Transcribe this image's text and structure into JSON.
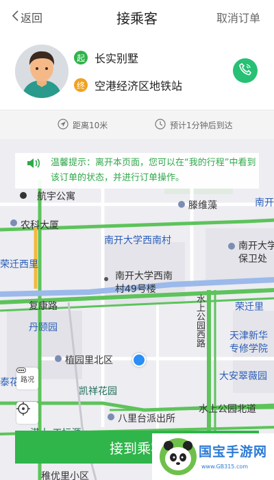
{
  "header": {
    "back_label": "返回",
    "title": "接乘客",
    "cancel_label": "取消订单"
  },
  "passenger": {
    "start_tag": "起",
    "start": "长实别墅",
    "end_tag": "终",
    "end": "空港经济区地铁站"
  },
  "trip_info": {
    "distance": "距离10米",
    "eta": "预计1分钟后到达"
  },
  "tip": {
    "text": "温馨提示：离开本页面，您可以在“我的行程”中看到该订单的状态，并进行订单操作。"
  },
  "map": {
    "labels": {
      "hangyu": "航宇公寓",
      "tengweizao": "滕维藻",
      "nankai_corner": "南开",
      "nongke": "农科大厦",
      "nankai_xinan": "南开大学西南村",
      "nankai_baowei": "南开大学",
      "baowei": "保卫处",
      "rongqian_west": "荣迁西里",
      "building49_a": "南开大学西南",
      "building49_b": "村49号楼",
      "fukang": "复康路",
      "rongqianli": "荣迁里",
      "danyi": "丹颐园",
      "tianjin_xinhua_a": "天津新华",
      "tianjin_xinhua_b": "专修学院",
      "zhiyuan": "植园里北区",
      "tai": "泰花",
      "dawa": "大安翠薇园",
      "kaixiang": "凯祥花园",
      "water_road": "水上公园北道",
      "road_vertical": "水上公园西路",
      "balitai": "八里台派出所",
      "jiyou": "稚优里小区",
      "partial": "港士 工坛源"
    },
    "traffic_label": "路况"
  },
  "action": {
    "arrive_label": "接到乘客"
  },
  "watermark": {
    "name": "国宝手游网",
    "url": "www.GB315.com"
  },
  "colors": {
    "accent": "#2fb54a",
    "route": "#2a8ff7"
  }
}
